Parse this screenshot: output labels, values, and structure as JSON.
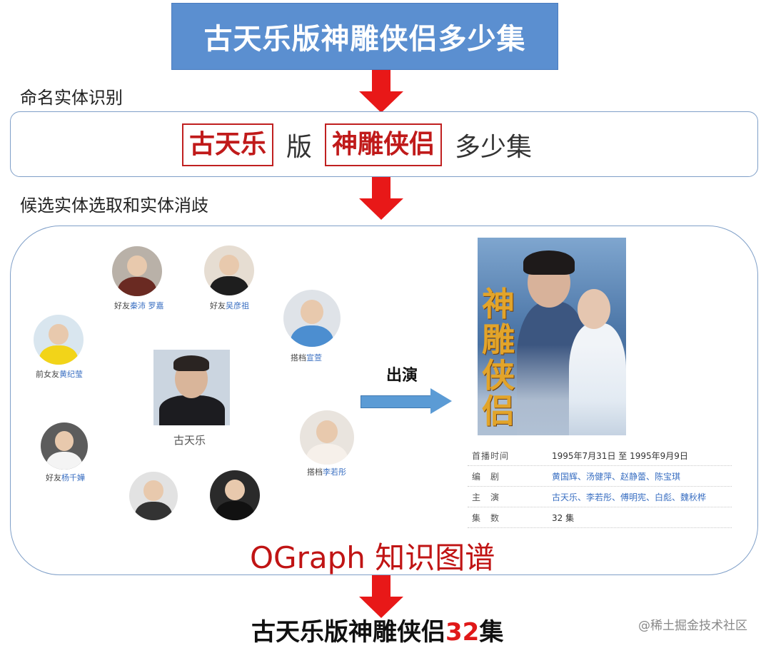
{
  "query": "古天乐版神雕侠侣多少集",
  "steps": {
    "ner": "命名实体识别",
    "disambiguation": "候选实体选取和实体消歧"
  },
  "ner_tokens": {
    "entity1": "古天乐",
    "plain1": "版",
    "entity2": "神雕侠侣",
    "plain2": "多少集"
  },
  "graph": {
    "center": "古天乐",
    "relation": "出演",
    "nodes": [
      {
        "prefix": "好友",
        "names": "秦沛 罗嘉"
      },
      {
        "prefix": "好友",
        "names": "吴彦祖"
      },
      {
        "prefix": "搭档",
        "names": "宣萱"
      },
      {
        "prefix": "前女友",
        "names": "黄纪莹"
      },
      {
        "prefix": "好友",
        "names": "杨千嬅"
      },
      {
        "prefix": "搭档",
        "names": "李若彤"
      }
    ],
    "poster_title": [
      "神",
      "雕",
      "侠",
      "侣"
    ],
    "info": [
      {
        "key": "首播时间",
        "value": "1995年7月31日 至 1995年9月9日"
      },
      {
        "key": "编　剧",
        "value": "黄国辉、汤健萍、赵静蕾、陈宝琪"
      },
      {
        "key": "主　演",
        "value": "古天乐、李若彤、傅明宪、白彪、魏秋桦"
      },
      {
        "key": "集　数",
        "value": "32 集"
      }
    ],
    "title": "OGraph 知识图谱"
  },
  "result": {
    "text": "古天乐版神雕侠侣",
    "number": "32",
    "suffix": "集"
  },
  "watermark": "@稀土掘金技术社区",
  "colors": {
    "query_bg": "#5b8fd0",
    "arrow_red": "#e81818",
    "entity_red": "#c01a1a",
    "relation_arrow": "#5b9bd5"
  }
}
